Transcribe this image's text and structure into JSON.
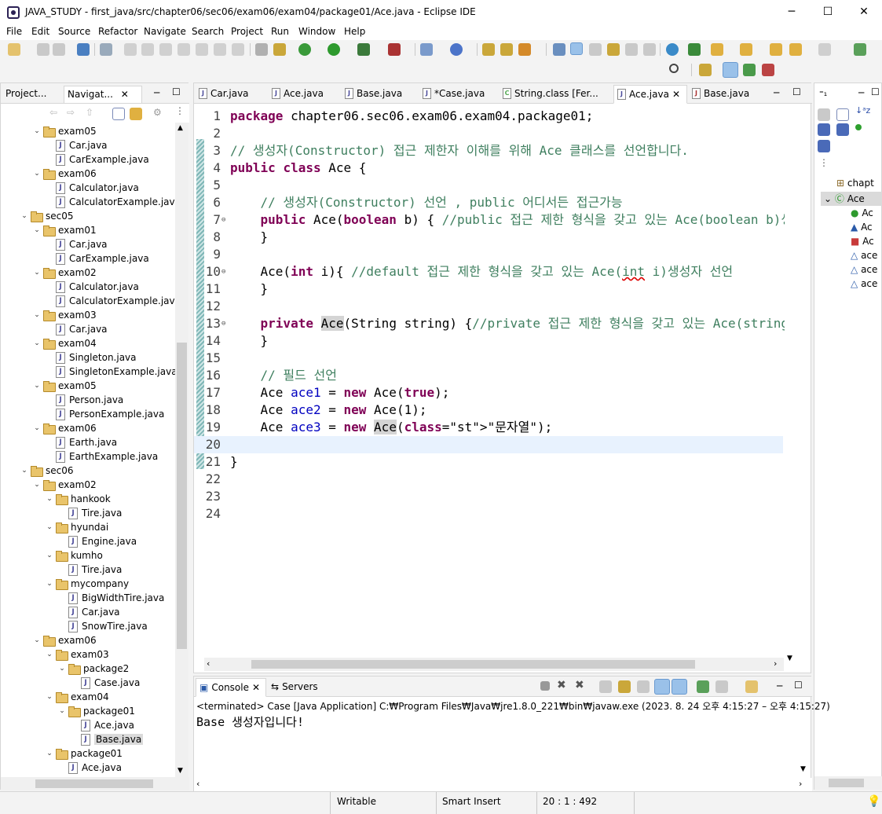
{
  "window": {
    "title": "JAVA_STUDY - first_java/src/chapter06/sec06/exam06/exam04/package01/Ace.java - Eclipse IDE",
    "minimize": "─",
    "maximize": "☐",
    "close": "✕"
  },
  "menu": [
    "File",
    "Edit",
    "Source",
    "Refactor",
    "Navigate",
    "Search",
    "Project",
    "Run",
    "Window",
    "Help"
  ],
  "left_panel": {
    "tabs": [
      "Project...",
      "Navigat..."
    ],
    "tree": [
      {
        "label": "exam05",
        "type": "folder",
        "depth": 1,
        "expanded": true
      },
      {
        "label": "Car.java",
        "type": "java",
        "depth": 2
      },
      {
        "label": "CarExample.java",
        "type": "java",
        "depth": 2
      },
      {
        "label": "exam06",
        "type": "folder",
        "depth": 1,
        "expanded": true
      },
      {
        "label": "Calculator.java",
        "type": "java",
        "depth": 2
      },
      {
        "label": "CalculatorExample.java",
        "type": "java",
        "depth": 2
      },
      {
        "label": "sec05",
        "type": "folder",
        "depth": 0,
        "expanded": true
      },
      {
        "label": "exam01",
        "type": "folder",
        "depth": 1,
        "expanded": true
      },
      {
        "label": "Car.java",
        "type": "java",
        "depth": 2
      },
      {
        "label": "CarExample.java",
        "type": "java",
        "depth": 2
      },
      {
        "label": "exam02",
        "type": "folder",
        "depth": 1,
        "expanded": true
      },
      {
        "label": "Calculator.java",
        "type": "java",
        "depth": 2
      },
      {
        "label": "CalculatorExample.java",
        "type": "java",
        "depth": 2
      },
      {
        "label": "exam03",
        "type": "folder",
        "depth": 1,
        "expanded": true
      },
      {
        "label": "Car.java",
        "type": "java",
        "depth": 2
      },
      {
        "label": "exam04",
        "type": "folder",
        "depth": 1,
        "expanded": true
      },
      {
        "label": "Singleton.java",
        "type": "java",
        "depth": 2
      },
      {
        "label": "SingletonExample.java",
        "type": "java",
        "depth": 2
      },
      {
        "label": "exam05",
        "type": "folder",
        "depth": 1,
        "expanded": true
      },
      {
        "label": "Person.java",
        "type": "java",
        "depth": 2
      },
      {
        "label": "PersonExample.java",
        "type": "java",
        "depth": 2
      },
      {
        "label": "exam06",
        "type": "folder",
        "depth": 1,
        "expanded": true
      },
      {
        "label": "Earth.java",
        "type": "java",
        "depth": 2
      },
      {
        "label": "EarthExample.java",
        "type": "java",
        "depth": 2
      },
      {
        "label": "sec06",
        "type": "folder",
        "depth": 0,
        "expanded": true
      },
      {
        "label": "exam02",
        "type": "folder",
        "depth": 1,
        "expanded": true
      },
      {
        "label": "hankook",
        "type": "folder",
        "depth": 2,
        "expanded": true
      },
      {
        "label": "Tire.java",
        "type": "java",
        "depth": 3
      },
      {
        "label": "hyundai",
        "type": "folder",
        "depth": 2,
        "expanded": true
      },
      {
        "label": "Engine.java",
        "type": "java",
        "depth": 3
      },
      {
        "label": "kumho",
        "type": "folder",
        "depth": 2,
        "expanded": true
      },
      {
        "label": "Tire.java",
        "type": "java",
        "depth": 3
      },
      {
        "label": "mycompany",
        "type": "folder",
        "depth": 2,
        "expanded": true
      },
      {
        "label": "BigWidthTire.java",
        "type": "java",
        "depth": 3
      },
      {
        "label": "Car.java",
        "type": "java",
        "depth": 3
      },
      {
        "label": "SnowTire.java",
        "type": "java",
        "depth": 3
      },
      {
        "label": "exam06",
        "type": "folder",
        "depth": 1,
        "expanded": true
      },
      {
        "label": "exam03",
        "type": "folder",
        "depth": 2,
        "expanded": true
      },
      {
        "label": "package2",
        "type": "folder",
        "depth": 3,
        "expanded": true
      },
      {
        "label": "Case.java",
        "type": "java",
        "depth": 4
      },
      {
        "label": "exam04",
        "type": "folder",
        "depth": 2,
        "expanded": true
      },
      {
        "label": "package01",
        "type": "folder",
        "depth": 3,
        "expanded": true
      },
      {
        "label": "Ace.java",
        "type": "java",
        "depth": 4
      },
      {
        "label": "Base.java",
        "type": "java",
        "depth": 4,
        "selected": true
      },
      {
        "label": "package01",
        "type": "folder",
        "depth": 2,
        "expanded": true
      },
      {
        "label": "Ace.java",
        "type": "java",
        "depth": 3
      }
    ]
  },
  "editor": {
    "tabs": [
      "Car.java",
      "Ace.java",
      "Base.java",
      "*Case.java",
      "String.class [Fer...",
      "Ace.java",
      "Base.java"
    ],
    "active_tab": 5,
    "current_line": 20,
    "lines": [
      {
        "n": "1",
        "t": "package chapter06.sec06.exam06.exam04.package01;"
      },
      {
        "n": "2",
        "t": ""
      },
      {
        "n": "3",
        "t": "// 생성자(Constructor) 접근 제한자 이해를 위해 Ace 클래스를 선언합니다."
      },
      {
        "n": "4",
        "t": "public class Ace {"
      },
      {
        "n": "5",
        "t": ""
      },
      {
        "n": "6",
        "t": "    // 생성자(Constructor) 선언 , public 어디서든 접근가능"
      },
      {
        "n": "7",
        "t": "    public Ace(boolean b) { //public 접근 제한 형식을 갖고 있는 Ace(boolean b)생"
      },
      {
        "n": "8",
        "t": "    }"
      },
      {
        "n": "9",
        "t": ""
      },
      {
        "n": "10",
        "t": "    Ace(int i){ //default 접근 제한 형식을 갖고 있는 Ace(int i)생성자 선언"
      },
      {
        "n": "11",
        "t": "    }"
      },
      {
        "n": "12",
        "t": ""
      },
      {
        "n": "13",
        "t": "    private Ace(String string) {//private 접근 제한 형식을 갖고 있는 Ace(string"
      },
      {
        "n": "14",
        "t": "    }"
      },
      {
        "n": "15",
        "t": ""
      },
      {
        "n": "16",
        "t": "    // 필드 선언"
      },
      {
        "n": "17",
        "t": "    Ace ace1 = new Ace(true);"
      },
      {
        "n": "18",
        "t": "    Ace ace2 = new Ace(1);"
      },
      {
        "n": "19",
        "t": "    Ace ace3 = new Ace(\"문자열\");"
      },
      {
        "n": "20",
        "t": ""
      },
      {
        "n": "21",
        "t": "}"
      },
      {
        "n": "22",
        "t": ""
      },
      {
        "n": "23",
        "t": ""
      },
      {
        "n": "24",
        "t": ""
      }
    ]
  },
  "outline": {
    "items": [
      "chapt",
      "Ace",
      "Ac",
      "Ac",
      "Ac",
      "ace",
      "ace",
      "ace"
    ]
  },
  "console": {
    "tabs": [
      "Console",
      "Servers"
    ],
    "status": "<terminated> Case [Java Application] C:₩Program Files₩Java₩jre1.8.0_221₩bin₩javaw.exe  (2023. 8. 24 오후 4:15:27 – 오후 4:15:27)",
    "output": "Base 생성자입니다!"
  },
  "statusbar": {
    "writable": "Writable",
    "insert_mode": "Smart Insert",
    "position": "20 : 1 : 492"
  }
}
